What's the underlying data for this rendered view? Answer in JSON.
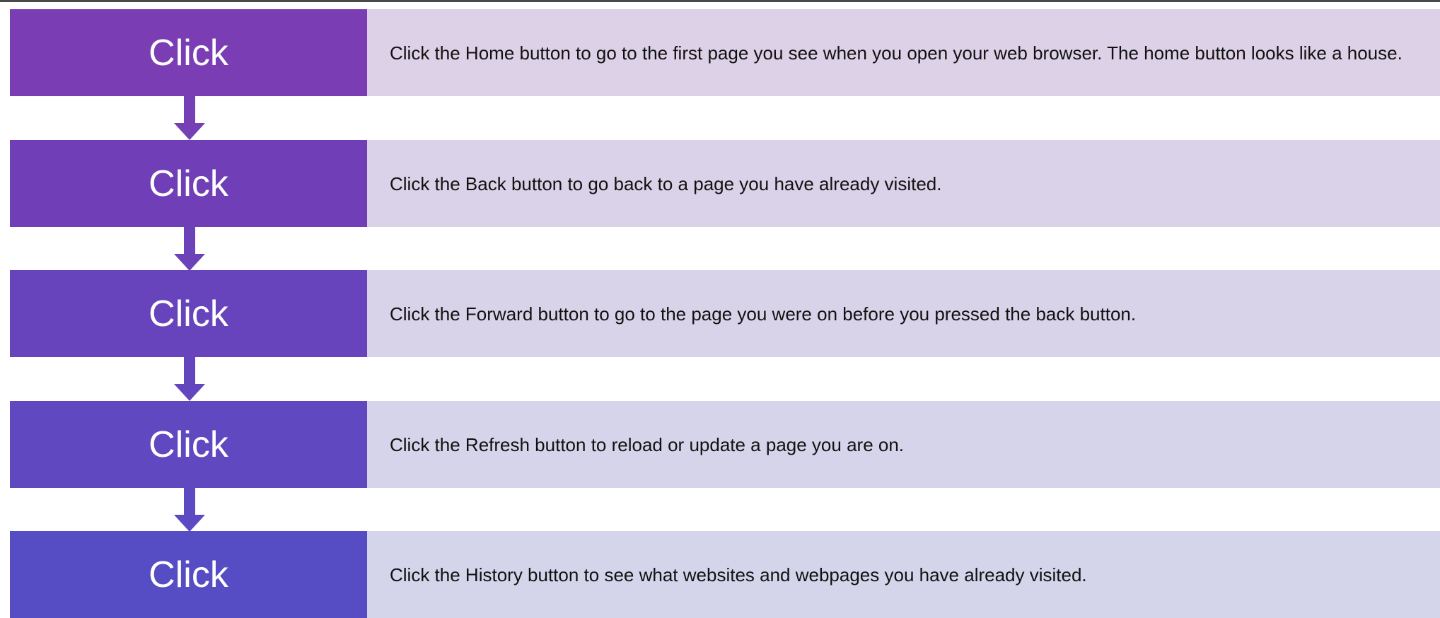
{
  "steps": [
    {
      "label": "Click",
      "description": "Click the Home button to go to the first  page you see when you open your web browser. The home button looks like a house.",
      "label_color": "#7a3db3",
      "text_bg": "#dcd1e7"
    },
    {
      "label": "Click",
      "description": "Click the Back button to go back to a page you have already visited.",
      "label_color": "#703fb8",
      "text_bg": "#dad2e8"
    },
    {
      "label": "Click",
      "description": "Click the Forward button to go to the page you were on before you pressed the back button.",
      "label_color": "#6744bb",
      "text_bg": "#d8d3e9"
    },
    {
      "label": "Click",
      "description": "Click the Refresh button to reload or update a page you  are on.",
      "label_color": "#5f48c0",
      "text_bg": "#d6d4ea"
    },
    {
      "label": "Click",
      "description": "Click the History button to see what websites and webpages you have already visited.",
      "label_color": "#564dc4",
      "text_bg": "#d4d5eb"
    }
  ],
  "connector_colors": [
    "#7540b6",
    "#6c42b9",
    "#6346bd",
    "#5b4ac2"
  ],
  "connector_icon": "down-arrow-icon"
}
